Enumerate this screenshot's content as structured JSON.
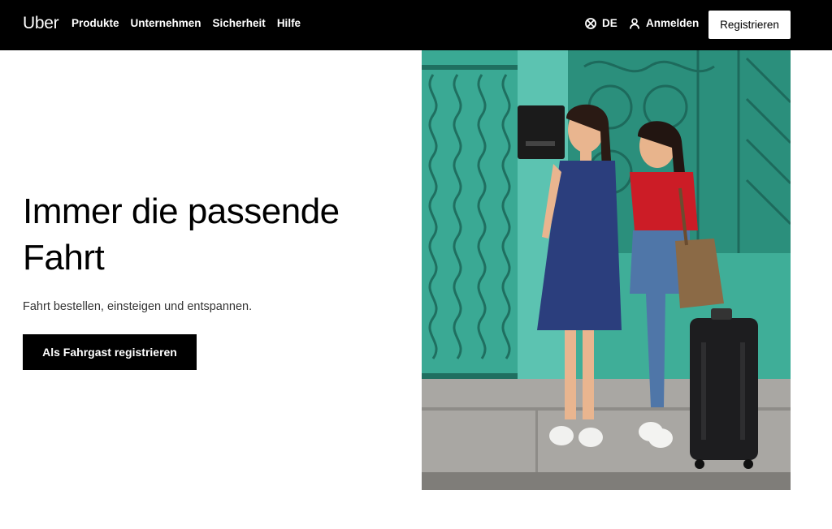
{
  "header": {
    "logo": "Uber",
    "nav": [
      "Produkte",
      "Unternehmen",
      "Sicherheit",
      "Hilfe"
    ],
    "language": "DE",
    "login": "Anmelden",
    "register": "Registrieren"
  },
  "hero": {
    "title": "Immer die passende Fahrt",
    "subtitle": "Fahrt bestellen, einsteigen und entspannen.",
    "cta": "Als Fahrgast registrieren"
  },
  "colors": {
    "header_bg": "#000000",
    "accent": "#000000",
    "background": "#ffffff"
  }
}
